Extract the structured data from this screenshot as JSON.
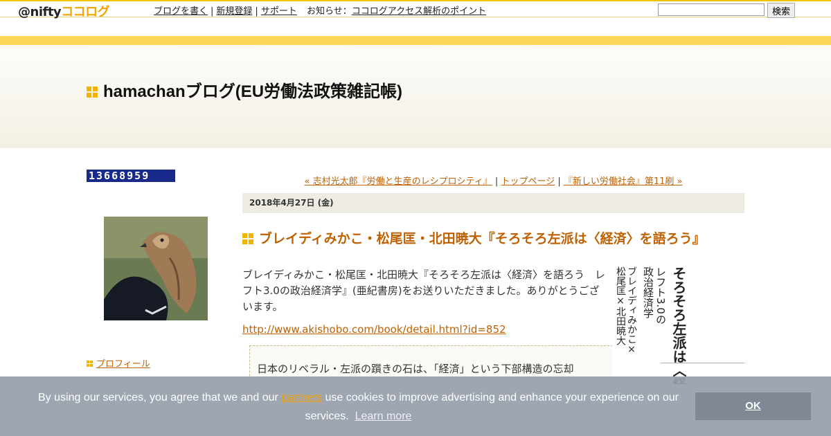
{
  "topbar": {
    "logo_nifty": "@nifty",
    "logo_kokolog": "ココログ",
    "nav": [
      "ブログを書く",
      "新規登録",
      "サポート"
    ],
    "notice_label": "お知らせ",
    "notice_link": "ココログアクセス解析のポイント",
    "search_button": "検索"
  },
  "header": {
    "title": "hamachanブログ(EU労働法政策雑記帳)"
  },
  "sidebar": {
    "counter": "13668959",
    "profile_link": "プロフィール"
  },
  "pager": {
    "prev": "« 志村光太郎『労働と生産のレシプロシティ』",
    "top": "トップページ",
    "next": "『新しい労働社会』第11刷 »"
  },
  "entry": {
    "date": "2018年4月27日 (金)",
    "title": "ブレイディみかこ・松尾匡・北田暁大『そろそろ左派は〈経済〉を語ろう』",
    "body": "ブレイディみかこ・松尾匡・北田暁大『そろそろ左派は〈経済〉を語ろう　レフト3.0の政治経済学』(亜紀書房)をお送りいただきました。ありがとうございます。",
    "link": "http://www.akishobo.com/book/detail.html?id=852",
    "quote": "日本のリベラル・左派の躓きの石は、「経済」という下部構造の忘却"
  },
  "book": {
    "col1": "そろそろ左派は〈経",
    "col2": "レフト3.0の",
    "col3": "政治経済学",
    "col4": "ブレイディみかこ×",
    "col5": "松尾匡×北田暁大"
  },
  "cookie": {
    "text_before": "By using our services, you agree that we and our ",
    "partners": "partners",
    "text_after": " use cookies to improve advertising and enhance your experience on our services.",
    "learn_more": "Learn more",
    "ok": "OK"
  },
  "colors": {
    "accent": "#f2b400",
    "link": "#c06000",
    "stripe": "#fdd75a"
  }
}
